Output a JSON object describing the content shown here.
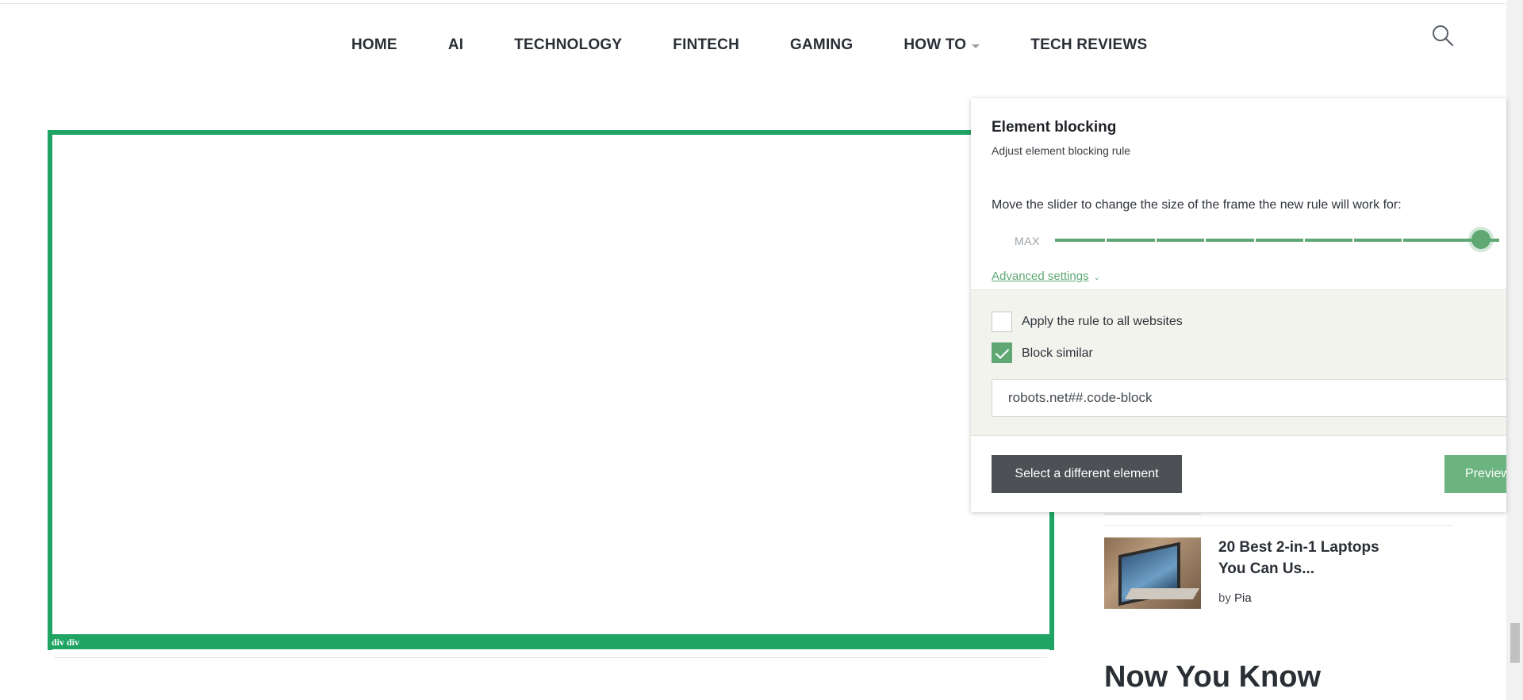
{
  "nav": {
    "items": [
      "HOME",
      "AI",
      "TECHNOLOGY",
      "FINTECH",
      "GAMING",
      "HOW TO",
      "TECH REVIEWS"
    ]
  },
  "highlight": {
    "label": "div div"
  },
  "sidebar": {
    "article": {
      "title": "20 Best 2-in-1 Laptops You Can Us...",
      "author_prefix": "by",
      "author": "Pia"
    },
    "section_title": "Now You Know"
  },
  "panel": {
    "title": "Element blocking",
    "subtitle": "Adjust element blocking rule",
    "slider_text": "Move the slider to change the size of the frame the new rule will work for:",
    "slider_max_label": "MAX",
    "slider_value": 1.0,
    "advanced_label": "Advanced settings",
    "options": [
      {
        "label": "Apply the rule to all websites",
        "checked": false
      },
      {
        "label": "Block similar",
        "checked": true
      }
    ],
    "rule_value": "robots.net##.code-block",
    "select_button": "Select a different element",
    "preview_button": "Preview"
  },
  "colors": {
    "accent_green": "#5fa874",
    "highlight_green": "#1fa464",
    "dark_button": "#4d5054"
  }
}
